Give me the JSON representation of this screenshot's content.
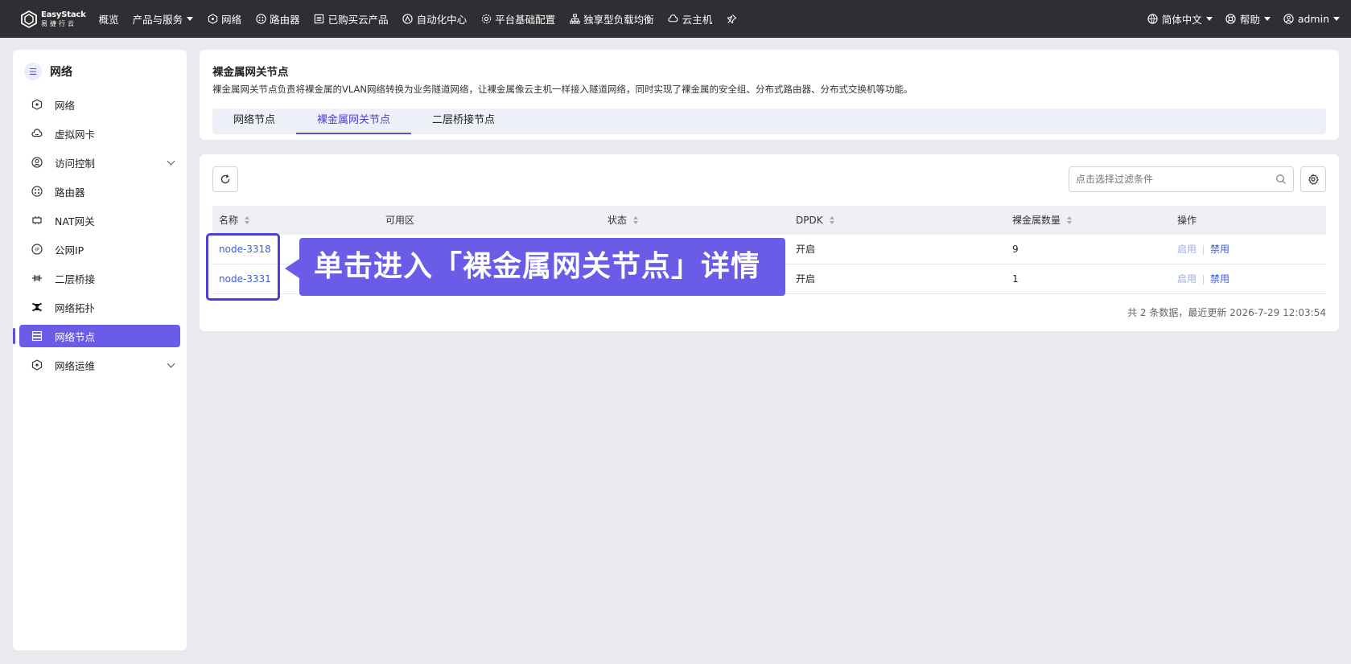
{
  "topbar": {
    "logo_en": "EasyStack",
    "logo_cn": "易捷行云",
    "nav": [
      {
        "label": "概览",
        "icon": ""
      },
      {
        "label": "产品与服务",
        "icon": "",
        "dropdown": true
      },
      {
        "label": "网络",
        "icon": "network-icon"
      },
      {
        "label": "路由器",
        "icon": "router-icon"
      },
      {
        "label": "已购买云产品",
        "icon": "list-icon"
      },
      {
        "label": "自动化中心",
        "icon": "automation-icon"
      },
      {
        "label": "平台基础配置",
        "icon": "gear-icon"
      },
      {
        "label": "独享型负载均衡",
        "icon": "load-balancer-icon"
      },
      {
        "label": "云主机",
        "icon": "cloud-host-icon"
      }
    ],
    "right": {
      "language": "简体中文",
      "help": "帮助",
      "user": "admin"
    }
  },
  "sidebar": {
    "title": "网络",
    "items": [
      {
        "label": "网络",
        "icon": "network-icon"
      },
      {
        "label": "虚拟网卡",
        "icon": "virtual-nic-icon"
      },
      {
        "label": "访问控制",
        "icon": "access-control-icon",
        "expandable": true
      },
      {
        "label": "路由器",
        "icon": "router-icon"
      },
      {
        "label": "NAT网关",
        "icon": "nat-gateway-icon"
      },
      {
        "label": "公网IP",
        "icon": "public-ip-icon"
      },
      {
        "label": "二层桥接",
        "icon": "bridge-icon"
      },
      {
        "label": "网络拓扑",
        "icon": "topology-icon"
      },
      {
        "label": "网络节点",
        "icon": "server-icon",
        "active": true
      },
      {
        "label": "网络运维",
        "icon": "network-ops-icon",
        "expandable": true
      }
    ]
  },
  "header": {
    "title": "裸金属网关节点",
    "description": "裸金属网关节点负责将裸金属的VLAN网络转换为业务隧道网络，让裸金属像云主机一样接入隧道网络，同时实现了裸金属的安全组、分布式路由器、分布式交换机等功能。",
    "tabs": [
      {
        "label": "网络节点"
      },
      {
        "label": "裸金属网关节点",
        "active": true
      },
      {
        "label": "二层桥接节点"
      }
    ]
  },
  "table": {
    "search_placeholder": "点击选择过滤条件",
    "columns": [
      "名称",
      "可用区",
      "状态",
      "DPDK",
      "裸金属数量",
      "操作"
    ],
    "rows": [
      {
        "name": "node-3318",
        "dpdk": "开启",
        "count": "9",
        "op_enable": "启用",
        "op_disable": "禁用"
      },
      {
        "name": "node-3331",
        "dpdk": "开启",
        "count": "1",
        "op_enable": "启用",
        "op_disable": "禁用"
      }
    ],
    "footer": "共 2 条数据，最近更新  2026-7-29 12:03:54"
  },
  "annotation": {
    "callout": "单击进入「裸金属网关节点」详情",
    "color": "#6b5ce8"
  }
}
